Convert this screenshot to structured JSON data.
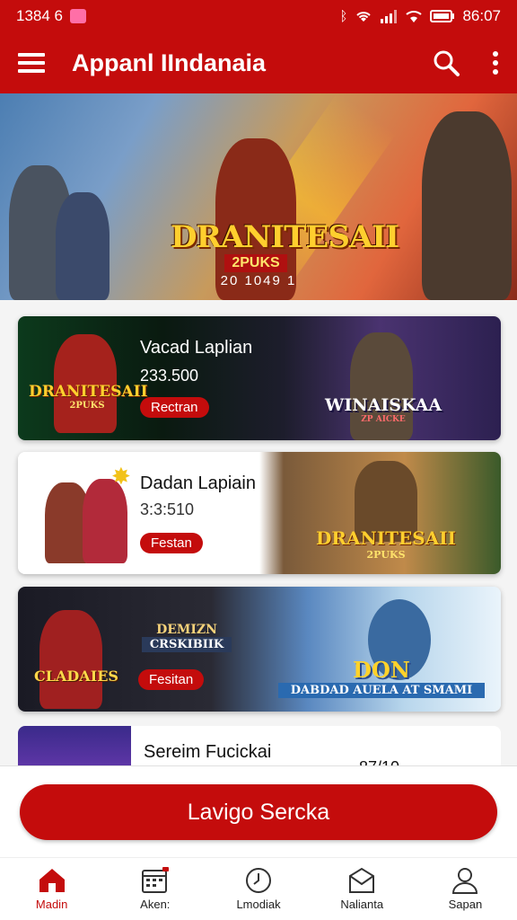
{
  "status_bar": {
    "left_text": "1384 6",
    "time": "86:07"
  },
  "app_bar": {
    "title": "Appanl IIndanaia"
  },
  "hero": {
    "logo_line1": "DRANITESAII",
    "logo_line2": "2PUKS",
    "caption": "20 1049 1"
  },
  "cards": [
    {
      "name": "Vacad Laplian",
      "number": "233.500",
      "pill": "Rectran",
      "left_logo1": "DRANITESAII",
      "left_logo2": "2PUKS",
      "right_logo1": "WINAISKAA",
      "right_logo2": "ZP AICKE"
    },
    {
      "name": "Dadan Lapiain",
      "number": "3:3:510",
      "pill": "Festan",
      "right_logo1": "DRANITESAII",
      "right_logo2": "2PUKS"
    },
    {
      "left_logo1": "CLADAIES",
      "center_logo1": "DEMIZN",
      "center_logo2": "CRSKIBIIK",
      "pill": "Fesitan",
      "right_logo1": "DON",
      "right_logo2": "DABDAD AUELA AT SMAMI"
    },
    {
      "name": "Sereim Fucickai",
      "number": "87/10"
    }
  ],
  "cta": {
    "label": "Lavigo Sercka"
  },
  "nav": [
    {
      "label": "Madin",
      "icon": "home-icon",
      "active": true
    },
    {
      "label": "Aken:",
      "icon": "calendar-icon",
      "active": false
    },
    {
      "label": "Lmodiak",
      "icon": "clock-icon",
      "active": false
    },
    {
      "label": "Nalianta",
      "icon": "envelope-icon",
      "active": false
    },
    {
      "label": "Sapan",
      "icon": "user-icon",
      "active": false
    }
  ],
  "colors": {
    "brand": "#c40c0c"
  }
}
